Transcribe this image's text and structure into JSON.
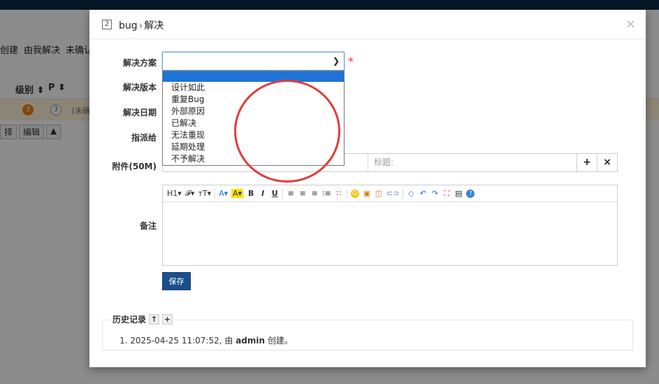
{
  "background": {
    "subnav": [
      "创建",
      "由我解决",
      "未确认"
    ],
    "table_headers": [
      "级别",
      "P"
    ],
    "row": {
      "severity": "3",
      "priority": "3",
      "status": "[未确"
    },
    "buttons": [
      "择",
      "编辑",
      "▲"
    ]
  },
  "modal": {
    "id": "2",
    "title_object": "bug",
    "title_action": "解决",
    "close_label": "×",
    "fields": {
      "resolution_label": "解决方案",
      "build_label": "解决版本",
      "date_label": "解决日期",
      "assign_label": "指派给",
      "attachment_label": "附件(50M)",
      "comment_label": "备注"
    },
    "resolution_options": [
      "",
      "设计如此",
      "重复Bug",
      "外部原因",
      "已解决",
      "无法重现",
      "延期处理",
      "不予解决"
    ],
    "attachment": {
      "title_placeholder": "标题:",
      "add_label": "+",
      "remove_label": "×"
    },
    "editor_toolbar": {
      "heading": "H1▾",
      "font": "𝓕▾",
      "size": "тT▾",
      "font_color": "A▾",
      "highlight": "A▾",
      "bold": "B",
      "italic": "I",
      "underline": "U"
    },
    "save_label": "保存",
    "history": {
      "title": "历史记录",
      "entry_index": "1.",
      "entry_time": "2025-04-25 11:07:52, 由",
      "entry_user": "admin",
      "entry_action": "创建。"
    }
  },
  "colors": {
    "accent": "#1a4f8b",
    "selection": "#1e73d8",
    "annotation": "#e23b3b"
  }
}
